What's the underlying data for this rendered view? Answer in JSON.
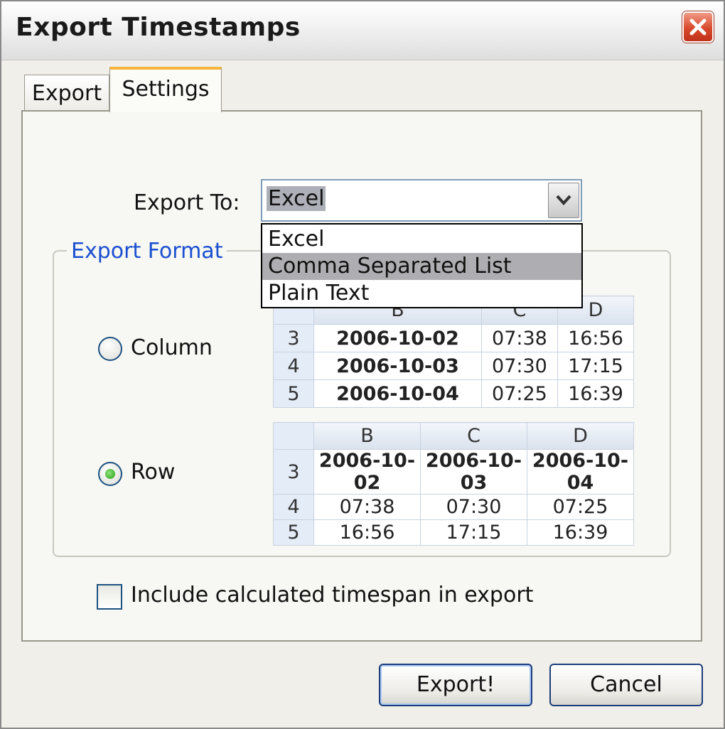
{
  "window": {
    "title": "Export Timestamps"
  },
  "tabs": [
    {
      "label": "Export"
    },
    {
      "label": "Settings"
    }
  ],
  "export_to": {
    "label": "Export To:",
    "value": "Excel",
    "options": [
      "Excel",
      "Comma Separated List",
      "Plain Text"
    ],
    "highlighted": "Comma Separated List"
  },
  "format_group": {
    "title": "Export Format",
    "column_label": "Column",
    "row_label": "Row",
    "selected": "Row"
  },
  "column_preview": {
    "headers": [
      "B",
      "C",
      "D"
    ],
    "rows": [
      {
        "num": "3",
        "cells": [
          "2006-10-02",
          "07:38",
          "16:56"
        ]
      },
      {
        "num": "4",
        "cells": [
          "2006-10-03",
          "07:30",
          "17:15"
        ]
      },
      {
        "num": "5",
        "cells": [
          "2006-10-04",
          "07:25",
          "16:39"
        ]
      }
    ]
  },
  "row_preview": {
    "headers": [
      "B",
      "C",
      "D"
    ],
    "rows": [
      {
        "num": "3",
        "cells": [
          "2006-10-02",
          "2006-10-03",
          "2006-10-04"
        ]
      },
      {
        "num": "4",
        "cells": [
          "07:38",
          "07:30",
          "07:25"
        ]
      },
      {
        "num": "5",
        "cells": [
          "16:56",
          "17:15",
          "16:39"
        ]
      }
    ]
  },
  "include_timespan": {
    "label": "Include calculated timespan in export",
    "checked": false
  },
  "buttons": {
    "export": "Export!",
    "cancel": "Cancel"
  },
  "colors": {
    "group_title": "#1a4fd0",
    "tab_accent": "#f5b43c",
    "close_button": "#d84a2c",
    "dropdown_highlight": "#aeaeb2"
  },
  "icons": {
    "close": "close-icon",
    "dropdown": "chevron-down-icon"
  }
}
